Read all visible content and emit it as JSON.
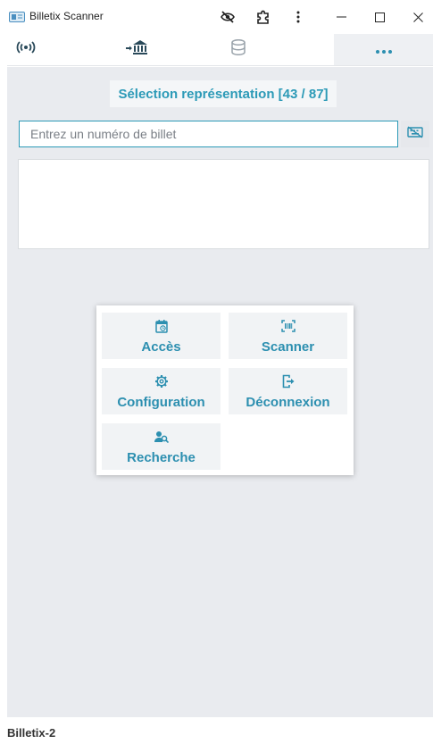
{
  "window": {
    "title": "Billetix Scanner",
    "icons": [
      "app-icon",
      "eye-slash-icon",
      "puzzle-icon",
      "kebab-menu-icon",
      "minimize-icon",
      "maximize-icon",
      "close-icon"
    ]
  },
  "toolbar": {
    "icons": [
      "wifi-signal-icon",
      "bank-arrow-icon",
      "database-icon",
      "ellipsis-icon"
    ],
    "active": "ellipsis-icon"
  },
  "main": {
    "selection_label": "Sélection représentation [43 / 87]",
    "ticket_input": {
      "placeholder": "Entrez un numéro de billet",
      "value": ""
    }
  },
  "menu": {
    "items": [
      {
        "label": "Accès",
        "icon": "calendar-clock-icon"
      },
      {
        "label": "Scanner",
        "icon": "barcode-scan-icon"
      },
      {
        "label": "Configuration",
        "icon": "gear-icon"
      },
      {
        "label": "Déconnexion",
        "icon": "logout-icon"
      },
      {
        "label": "Recherche",
        "icon": "user-search-icon"
      }
    ]
  },
  "status": {
    "device": "Billetix-2"
  },
  "colors": {
    "accent": "#2c9ab7",
    "background": "#e9ebef",
    "tile": "#f1f3f5",
    "toolbar_icon": "#2a4a5a"
  }
}
